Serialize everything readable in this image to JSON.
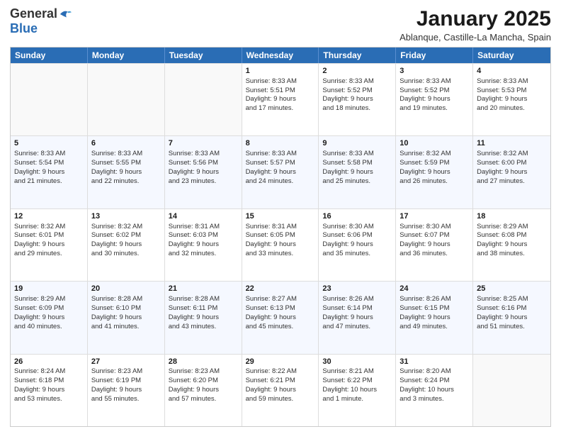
{
  "logo": {
    "general": "General",
    "blue": "Blue"
  },
  "header": {
    "month_title": "January 2025",
    "location": "Ablanque, Castille-La Mancha, Spain"
  },
  "weekdays": [
    "Sunday",
    "Monday",
    "Tuesday",
    "Wednesday",
    "Thursday",
    "Friday",
    "Saturday"
  ],
  "weeks": [
    [
      {
        "day": "",
        "info": ""
      },
      {
        "day": "",
        "info": ""
      },
      {
        "day": "",
        "info": ""
      },
      {
        "day": "1",
        "info": "Sunrise: 8:33 AM\nSunset: 5:51 PM\nDaylight: 9 hours\nand 17 minutes."
      },
      {
        "day": "2",
        "info": "Sunrise: 8:33 AM\nSunset: 5:52 PM\nDaylight: 9 hours\nand 18 minutes."
      },
      {
        "day": "3",
        "info": "Sunrise: 8:33 AM\nSunset: 5:52 PM\nDaylight: 9 hours\nand 19 minutes."
      },
      {
        "day": "4",
        "info": "Sunrise: 8:33 AM\nSunset: 5:53 PM\nDaylight: 9 hours\nand 20 minutes."
      }
    ],
    [
      {
        "day": "5",
        "info": "Sunrise: 8:33 AM\nSunset: 5:54 PM\nDaylight: 9 hours\nand 21 minutes."
      },
      {
        "day": "6",
        "info": "Sunrise: 8:33 AM\nSunset: 5:55 PM\nDaylight: 9 hours\nand 22 minutes."
      },
      {
        "day": "7",
        "info": "Sunrise: 8:33 AM\nSunset: 5:56 PM\nDaylight: 9 hours\nand 23 minutes."
      },
      {
        "day": "8",
        "info": "Sunrise: 8:33 AM\nSunset: 5:57 PM\nDaylight: 9 hours\nand 24 minutes."
      },
      {
        "day": "9",
        "info": "Sunrise: 8:33 AM\nSunset: 5:58 PM\nDaylight: 9 hours\nand 25 minutes."
      },
      {
        "day": "10",
        "info": "Sunrise: 8:32 AM\nSunset: 5:59 PM\nDaylight: 9 hours\nand 26 minutes."
      },
      {
        "day": "11",
        "info": "Sunrise: 8:32 AM\nSunset: 6:00 PM\nDaylight: 9 hours\nand 27 minutes."
      }
    ],
    [
      {
        "day": "12",
        "info": "Sunrise: 8:32 AM\nSunset: 6:01 PM\nDaylight: 9 hours\nand 29 minutes."
      },
      {
        "day": "13",
        "info": "Sunrise: 8:32 AM\nSunset: 6:02 PM\nDaylight: 9 hours\nand 30 minutes."
      },
      {
        "day": "14",
        "info": "Sunrise: 8:31 AM\nSunset: 6:03 PM\nDaylight: 9 hours\nand 32 minutes."
      },
      {
        "day": "15",
        "info": "Sunrise: 8:31 AM\nSunset: 6:05 PM\nDaylight: 9 hours\nand 33 minutes."
      },
      {
        "day": "16",
        "info": "Sunrise: 8:30 AM\nSunset: 6:06 PM\nDaylight: 9 hours\nand 35 minutes."
      },
      {
        "day": "17",
        "info": "Sunrise: 8:30 AM\nSunset: 6:07 PM\nDaylight: 9 hours\nand 36 minutes."
      },
      {
        "day": "18",
        "info": "Sunrise: 8:29 AM\nSunset: 6:08 PM\nDaylight: 9 hours\nand 38 minutes."
      }
    ],
    [
      {
        "day": "19",
        "info": "Sunrise: 8:29 AM\nSunset: 6:09 PM\nDaylight: 9 hours\nand 40 minutes."
      },
      {
        "day": "20",
        "info": "Sunrise: 8:28 AM\nSunset: 6:10 PM\nDaylight: 9 hours\nand 41 minutes."
      },
      {
        "day": "21",
        "info": "Sunrise: 8:28 AM\nSunset: 6:11 PM\nDaylight: 9 hours\nand 43 minutes."
      },
      {
        "day": "22",
        "info": "Sunrise: 8:27 AM\nSunset: 6:13 PM\nDaylight: 9 hours\nand 45 minutes."
      },
      {
        "day": "23",
        "info": "Sunrise: 8:26 AM\nSunset: 6:14 PM\nDaylight: 9 hours\nand 47 minutes."
      },
      {
        "day": "24",
        "info": "Sunrise: 8:26 AM\nSunset: 6:15 PM\nDaylight: 9 hours\nand 49 minutes."
      },
      {
        "day": "25",
        "info": "Sunrise: 8:25 AM\nSunset: 6:16 PM\nDaylight: 9 hours\nand 51 minutes."
      }
    ],
    [
      {
        "day": "26",
        "info": "Sunrise: 8:24 AM\nSunset: 6:18 PM\nDaylight: 9 hours\nand 53 minutes."
      },
      {
        "day": "27",
        "info": "Sunrise: 8:23 AM\nSunset: 6:19 PM\nDaylight: 9 hours\nand 55 minutes."
      },
      {
        "day": "28",
        "info": "Sunrise: 8:23 AM\nSunset: 6:20 PM\nDaylight: 9 hours\nand 57 minutes."
      },
      {
        "day": "29",
        "info": "Sunrise: 8:22 AM\nSunset: 6:21 PM\nDaylight: 9 hours\nand 59 minutes."
      },
      {
        "day": "30",
        "info": "Sunrise: 8:21 AM\nSunset: 6:22 PM\nDaylight: 10 hours\nand 1 minute."
      },
      {
        "day": "31",
        "info": "Sunrise: 8:20 AM\nSunset: 6:24 PM\nDaylight: 10 hours\nand 3 minutes."
      },
      {
        "day": "",
        "info": ""
      }
    ]
  ]
}
